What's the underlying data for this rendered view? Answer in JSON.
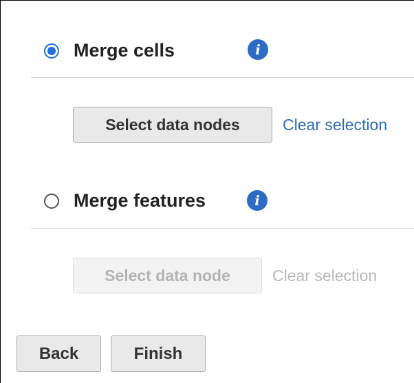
{
  "merge_cells": {
    "label": "Merge cells",
    "selected": true,
    "info_icon": "info-icon",
    "select_button": "Select data nodes",
    "clear_link": "Clear selection"
  },
  "merge_features": {
    "label": "Merge features",
    "selected": false,
    "info_icon": "info-icon",
    "select_button": "Select data node",
    "clear_link": "Clear selection"
  },
  "footer": {
    "back_label": "Back",
    "finish_label": "Finish"
  },
  "colors": {
    "accent": "#1f6fe0",
    "link": "#2e6db4",
    "info": "#2c6cc4",
    "disabled_text": "#b3b3b3"
  }
}
